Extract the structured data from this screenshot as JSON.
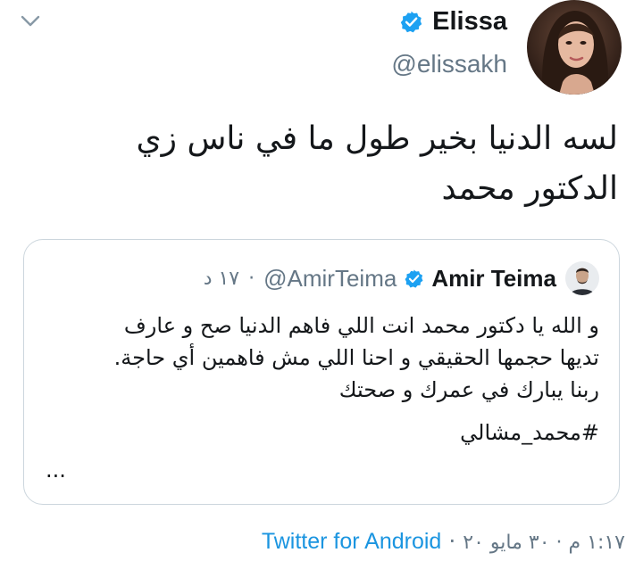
{
  "author": {
    "display_name": "Elissa",
    "handle": "@elissakh",
    "avatar_icon": "profile-photo",
    "verified_icon": "verified-badge-icon"
  },
  "tweet": {
    "text_line1": "لسه الدنيا بخير طول ما في ناس زي",
    "text_line2": "الدكتور محمد"
  },
  "quoted_tweet": {
    "display_name": "Amir Teima",
    "handle": "@AmirTeima",
    "separator": "·",
    "time": "١٧ د",
    "lines": [
      "و الله يا دكتور محمد انت اللي فاهم الدنيا صح و عارف",
      "تديها حجمها الحقيقي و احنا اللي مش فاهمين أي حاجة.",
      "ربنا يبارك في عمرك و صحتك"
    ],
    "hashtag": "#محمد_مشالي",
    "ellipsis": "..."
  },
  "footer": {
    "source": "Twitter for Android",
    "separator": "·",
    "datetime": "١:١٧ م · ٣٠ مايو ٢٠"
  },
  "colors": {
    "link": "#1b95e0",
    "secondary_text": "#657786",
    "primary_text": "#14171a",
    "border": "#ccd6dd",
    "verified": "#1da1f2"
  }
}
